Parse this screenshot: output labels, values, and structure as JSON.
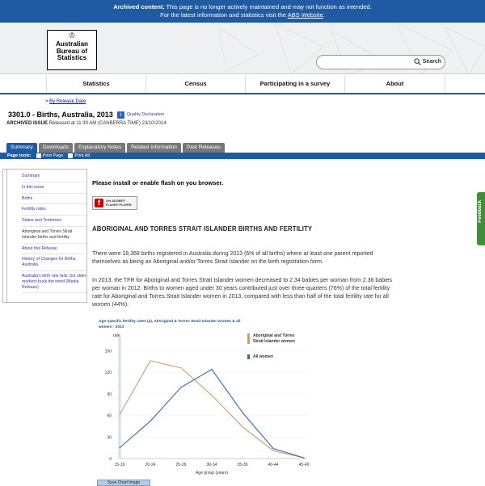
{
  "banner": {
    "strong": "Archived content.",
    "line1": " This page is no longer actively maintained and may not function as intended.",
    "line2_prefix": "For the latest information and statistics visit the ",
    "line2_link": "ABS Website",
    "line2_suffix": "."
  },
  "logo": {
    "line1": "Australian",
    "line2": "Bureau of",
    "line3": "Statistics"
  },
  "search": {
    "button": "Search",
    "placeholder": ""
  },
  "nav": {
    "items": [
      "Statistics",
      "Census",
      "Participating in a survey",
      "About"
    ]
  },
  "breadcrumb": {
    "prefix": "> ",
    "link": "By Release Date"
  },
  "page": {
    "title": "3301.0 - Births, Australia, 2013",
    "quality": "Quality Declaration",
    "archived_label": "ARCHIVED ISSUE",
    "archived_text": " Released at 11:30 AM (CANBERRA TIME) 23/10/2014"
  },
  "tabs": [
    "Summary",
    "Downloads",
    "Explanatory Notes",
    "Related Information",
    "Past Releases"
  ],
  "toolbar": {
    "label": "Page tools:",
    "print_page": "Print Page",
    "print_all": "Print All"
  },
  "sidebar": {
    "items": [
      "Summary",
      "In this issue",
      "Births",
      "Fertility rates",
      "States and Territories",
      "Aboriginal and Torres Strait Islander births and fertility",
      "About this Release",
      "History of Changes for Births, Australia",
      "Australia's birth rate falls, but older mothers buck the trend (Media Release)"
    ]
  },
  "main": {
    "flash_msg": "Please install or enable flash on you browser.",
    "flash_btn_line1": "Get ADOBE®",
    "flash_btn_line2": "FLASH® PLAYER",
    "heading": "ABORIGINAL AND TORRES STRAIT ISLANDER BIRTHS AND FERTILITY",
    "para1": "There were 18,368 births registered in Australia during 2013 (6% of all births) where at least one parent reported themselves as being an Aboriginal and/or Torres Strait Islander on the birth registration form.",
    "para2": "In 2013, the TFR for Aboriginal and Torres Strait Islander women decreased to 2.34 babies per woman from 2.38 babies per woman in 2012. Births to women aged under 30 years contributed just over three-quarters (76%) of the total fertility rate for Aboriginal and Torres Strait Islander women in 2013, compared with less than half of the total fertility rate for all women (44%)."
  },
  "chart_data": {
    "type": "line",
    "title": "Age-specific fertility rates (a), Aboriginal & Torres Strait Islander women & all women - 2013",
    "ylabel": "rate",
    "xlabel": "Age group (years)",
    "categories": [
      "15-19",
      "20-24",
      "25-29",
      "30-34",
      "35-39",
      "40-44",
      "45-49"
    ],
    "ylim": [
      0,
      165
    ],
    "yticks": [
      0,
      30,
      60,
      90,
      120,
      150
    ],
    "series": [
      {
        "name": "Aboriginal and Torres Strait Islander women",
        "color": "#d09a6a",
        "values": [
          61,
          136,
          126,
          88,
          44,
          11,
          1
        ]
      },
      {
        "name": "All women",
        "color": "#2f6db0",
        "values": [
          15,
          52,
          99,
          124,
          64,
          14,
          1
        ]
      }
    ],
    "save_label": "Save Chart Image"
  },
  "feedback": {
    "label": "Feedback"
  }
}
